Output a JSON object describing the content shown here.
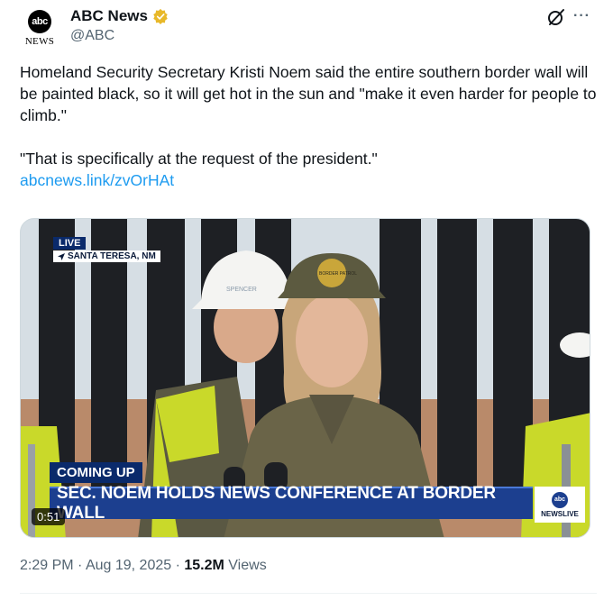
{
  "author": {
    "avatar_logo": "abc",
    "avatar_subtext": "NEWS",
    "display_name": "ABC News",
    "handle": "@ABC",
    "verified_badge": "gold-verified-icon",
    "verified_color": "#e8b829"
  },
  "actions": {
    "grok_icon": "grok-icon",
    "more_label": "···"
  },
  "tweet": {
    "body": "Homeland Security Secretary Kristi Noem said the entire southern border wall will be painted black, so it will get hot in the sun and \"make it even harder for people to climb.\"",
    "quote": "\"That is specifically at the request of the president.\"",
    "link": "abcnews.link/zvOrHAt"
  },
  "video": {
    "live_label": "LIVE",
    "location": "SANTA TERESA, NM",
    "coming_up": "COMING UP",
    "headline": "SEC. NOEM HOLDS NEWS CONFERENCE AT BORDER WALL",
    "logo_text": "abc",
    "brand": "NEWSLIVE",
    "duration": "0:51",
    "hardhat_text": "SPENCER",
    "cap_text": "BORDER PATROL"
  },
  "meta": {
    "time": "2:29 PM",
    "separator": "·",
    "date": "Aug 19, 2025",
    "views_count": "15.2M",
    "views_label": "Views"
  },
  "colors": {
    "link": "#1d9bf0",
    "secondary_text": "#536471",
    "lower_third": "#1c3f8f"
  }
}
